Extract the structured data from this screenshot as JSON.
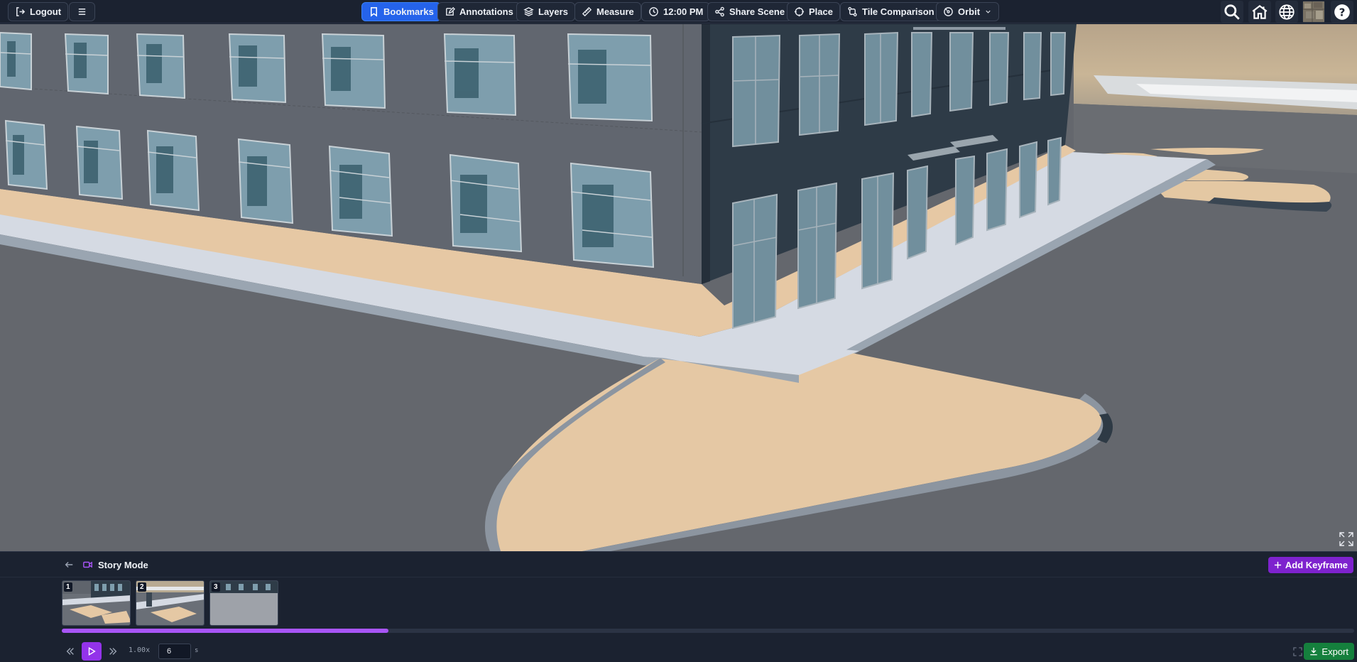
{
  "toolbar": {
    "logout_label": "Logout",
    "menu_icon": "hamburger-icon",
    "items": [
      {
        "label": "Bookmarks",
        "icon": "bookmark-icon",
        "active": true
      },
      {
        "label": "Annotations",
        "icon": "annotation-icon",
        "active": false
      },
      {
        "label": "Layers",
        "icon": "layers-icon",
        "active": false
      },
      {
        "label": "Measure",
        "icon": "ruler-icon",
        "active": false
      },
      {
        "label": "12:00 PM",
        "icon": "clock-icon",
        "active": false
      },
      {
        "label": "Share Scene",
        "icon": "share-icon",
        "active": false
      },
      {
        "label": "Place",
        "icon": "crosshair-icon",
        "active": false
      },
      {
        "label": "Tile Comparison",
        "icon": "compare-icon",
        "active": false
      },
      {
        "label": "Orbit",
        "icon": "orbit-icon",
        "active": false
      }
    ],
    "right_icons": [
      "search-icon",
      "home-icon",
      "globe-icon",
      "basemap-icon",
      "help-icon"
    ]
  },
  "story": {
    "title": "Story Mode",
    "add_keyframe_label": "Add Keyframe",
    "keyframes": [
      {
        "number": "1"
      },
      {
        "number": "2"
      },
      {
        "number": "3"
      }
    ],
    "progress": 0.253,
    "speed": "1.00x",
    "duration_value": "6",
    "duration_unit": "s",
    "export_label": "Export"
  },
  "colors": {
    "accent_blue": "#2563eb",
    "accent_purple": "#9333ea",
    "export_green": "#15803d",
    "panel_bg": "#1b2230"
  }
}
